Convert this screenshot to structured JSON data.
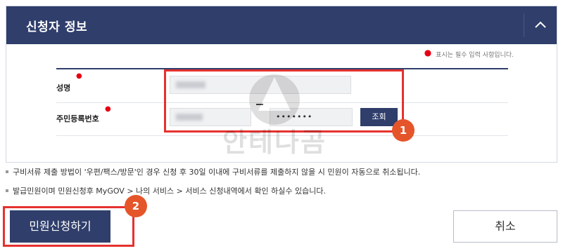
{
  "panel": {
    "title": "신청자 정보",
    "toggle_icon": "chevron-up-icon",
    "required_note": "표시는 필수 입력 사항입니다."
  },
  "form": {
    "name_label": "성명",
    "rrn_label": "주민등록번호",
    "password_mask": "•••••••",
    "lookup_button": "조회"
  },
  "badges": {
    "first": "1",
    "second": "2"
  },
  "notices": [
    "구비서류 제출 방법이 '우편/팩스/방문'인 경우 신청 후 30일 이내에 구비서류를 제출하지 않을 시 민원이 자동으로 취소됩니다.",
    "발급민원이며 민원신청후 MyGOV > 나의 서비스 > 서비스 신청내역에서 확인 하실수 있습니다."
  ],
  "actions": {
    "apply": "민원신청하기",
    "cancel": "취소"
  },
  "watermark": "안테나곰",
  "colors": {
    "navy": "#2f3e6b",
    "highlight": "#e5312f",
    "badge": "#e5552a",
    "required": "#e60012"
  }
}
